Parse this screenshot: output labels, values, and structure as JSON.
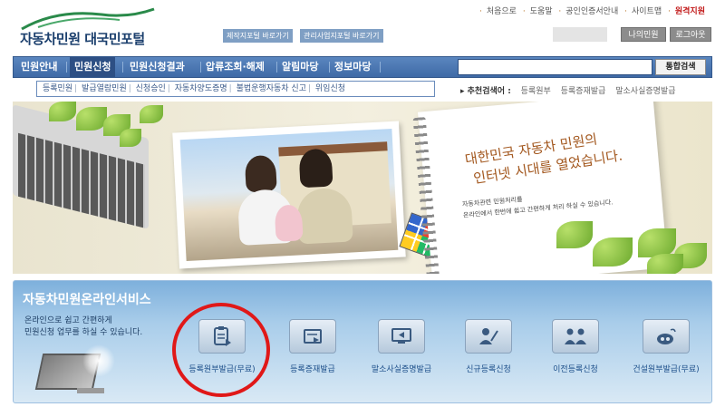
{
  "header": {
    "logo_text": "자동차민원 대국민포털",
    "quick_links": [
      "제작지포털 바로가기",
      "관리사업지포털 바로가기"
    ],
    "util_links": [
      "처음으로",
      "도움말",
      "공인인증서안내",
      "사이트맵"
    ],
    "remote_support": "원격지원",
    "my_page_button": "나의민원",
    "logout_button": "로그아웃"
  },
  "gnb": {
    "items": [
      "민원안내",
      "민원신청",
      "민원신청결과",
      "압류조회·해제",
      "알림마당",
      "정보마당"
    ],
    "active_index": 1,
    "search_placeholder": "",
    "search_button": "통합검색"
  },
  "submenu": {
    "items": [
      "등록민원",
      "발급열람민원",
      "신청승인",
      "자동차양도증명",
      "불법운행자동차 신고",
      "위임신청"
    ]
  },
  "recommend": {
    "label": "추천검색어",
    "keywords": [
      "등록원부",
      "등록증재발급",
      "말소사실증명발급"
    ]
  },
  "hero": {
    "slogan_line1": "대한민국 자동차 민원의",
    "slogan_line2": "인터넷 시대를 열었습니다.",
    "desc_line1": "자동차관련 민원처리를",
    "desc_line2": "온라인에서 한번에 쉽고 간편하게 처리 하실 수 있습니다."
  },
  "service": {
    "title": "자동차민원온라인서비스",
    "desc_line1": "온라인으로 쉽고 간편하게",
    "desc_line2": "민원신청 업무를 하실 수 있습니다.",
    "items": [
      {
        "label": "등록원부발급(무료)",
        "icon": "clipboard-icon"
      },
      {
        "label": "등록증재발급",
        "icon": "document-reissue-icon"
      },
      {
        "label": "말소사실증명발급",
        "icon": "monitor-arrow-icon"
      },
      {
        "label": "신규등록신청",
        "icon": "person-pen-icon"
      },
      {
        "label": "이전등록신청",
        "icon": "people-transfer-icon"
      },
      {
        "label": "건설원부발급(무료)",
        "icon": "construction-icon"
      }
    ]
  },
  "colors": {
    "gnb_blue": "#3f6aa6",
    "highlight_red": "#e01818",
    "remote_red": "#c21a1a"
  }
}
